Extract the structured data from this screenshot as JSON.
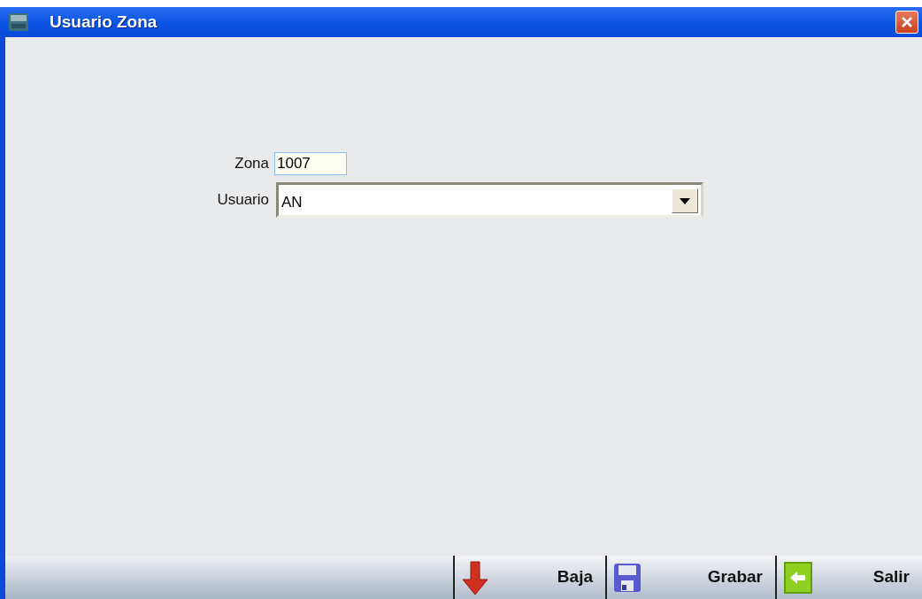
{
  "window": {
    "title": "Usuario Zona"
  },
  "form": {
    "fields": [
      {
        "kind": "text",
        "label": "Zona",
        "value": "1007"
      },
      {
        "kind": "dropdown",
        "label": "Usuario",
        "value": "AN"
      }
    ]
  },
  "buttons": [
    {
      "kind": "delete",
      "label": "Baja"
    },
    {
      "kind": "save",
      "label": "Grabar"
    },
    {
      "kind": "exit",
      "label": "Salir"
    }
  ]
}
